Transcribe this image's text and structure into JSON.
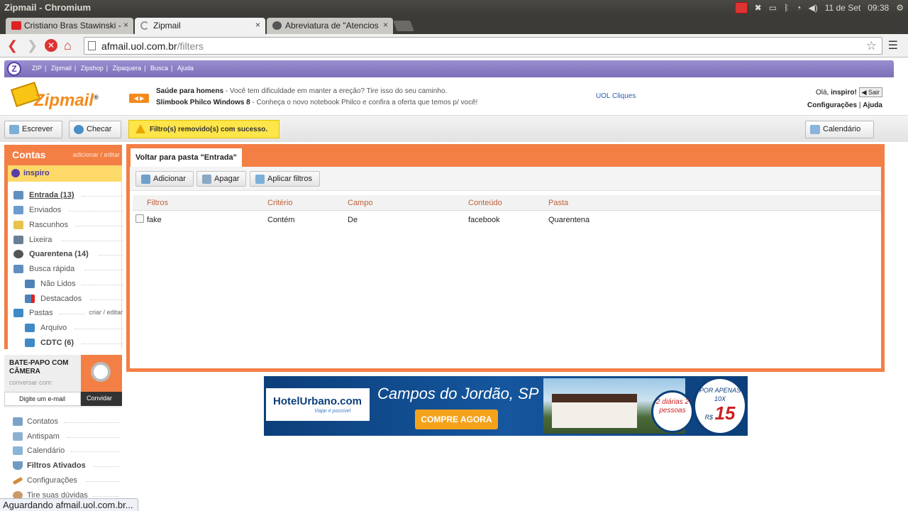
{
  "os": {
    "window_title": "Zipmail - Chromium",
    "date": "11 de Set",
    "time": "09:38"
  },
  "browser": {
    "tabs": [
      {
        "title": "Cristiano Bras Stawinski -",
        "favicon": "youtube-icon",
        "active": false
      },
      {
        "title": "Zipmail",
        "favicon": "loading-icon",
        "active": true
      },
      {
        "title": "Abreviatura de \"Atencios",
        "favicon": "avatar-icon",
        "active": false
      }
    ],
    "tab_close": "×",
    "url_host": "afmail.uol.com.br",
    "url_path": "/filters",
    "status_text": "Aguardando afmail.uol.com.br..."
  },
  "zipbar": {
    "links": [
      "ZIP",
      "Zipmail",
      "Zipshop",
      "Zipaquera",
      "Busca",
      "Ajuda"
    ],
    "separator": "|"
  },
  "header": {
    "logo_text": "Zipmail",
    "logo_reg": "®",
    "ads": [
      {
        "title": "Saúde para homens",
        "text": " - Você tem dificuldade em manter a ereção? Tire isso do seu caminho."
      },
      {
        "title": "Slimbook Philco Windows 8",
        "text": " - Conheça o novo notebook Philco e confira a oferta que temos p/ você!"
      }
    ],
    "uol_cliques": "UOL Cliques",
    "greeting": "Olá, ",
    "username": "inspiro!",
    "sair": "Sair",
    "configuracoes": "Configurações",
    "ajuda": "Ajuda",
    "sep": "|"
  },
  "toolbar": {
    "escrever": "Escrever",
    "checar": "Checar",
    "success": "Filtro(s) removido(s) com sucesso.",
    "calendario": "Calendário"
  },
  "sidebar": {
    "contas": "Contas",
    "adicionar_editar": "adicionar / editar",
    "account": "inspiro",
    "folders": [
      {
        "label": "Entrada (13)",
        "bold": true,
        "icon": "inbox-icon"
      },
      {
        "label": "Enviados",
        "bold": false,
        "icon": "sent-icon"
      },
      {
        "label": "Rascunhos",
        "bold": false,
        "icon": "drafts-icon"
      },
      {
        "label": "Lixeira",
        "bold": false,
        "icon": "trash-icon"
      },
      {
        "label": "Quarentena (14)",
        "bold": true,
        "icon": "quarantine-icon"
      },
      {
        "label": "Busca rápida",
        "bold": false,
        "icon": "search-folder-icon"
      },
      {
        "label": "Não Lidos",
        "bold": false,
        "icon": "unread-icon"
      },
      {
        "label": "Destacados",
        "bold": false,
        "icon": "flagged-icon"
      },
      {
        "label": "Pastas",
        "bold": false,
        "icon": "folders-icon"
      },
      {
        "label": "Arquivo",
        "bold": false,
        "icon": "folder-icon"
      },
      {
        "label": "CDTC (6)",
        "bold": true,
        "icon": "folder-icon"
      }
    ],
    "criar_editar": "criar / editar",
    "chat_title": "BATE-PAPO COM CÂMERA",
    "chat_sub": "conversar com:",
    "chat_input": "Digite um e-mail",
    "chat_button": "Convidar",
    "tools": [
      {
        "label": "Contatos",
        "bold": false,
        "icon": "contacts-icon"
      },
      {
        "label": "Antispam",
        "bold": false,
        "icon": "antispam-icon"
      },
      {
        "label": "Calendário",
        "bold": false,
        "icon": "calendar-icon"
      },
      {
        "label": "Filtros Ativados",
        "bold": true,
        "icon": "filter-icon"
      },
      {
        "label": "Configurações",
        "bold": false,
        "icon": "settings-icon"
      },
      {
        "label": "Tire suas dúvidas",
        "bold": false,
        "icon": "help-icon"
      }
    ]
  },
  "main": {
    "back": "Voltar para pasta \"Entrada\"",
    "buttons": [
      "Adicionar",
      "Apagar",
      "Aplicar filtros"
    ],
    "columns": [
      "Filtros",
      "Critério",
      "Campo",
      "Conteúdo",
      "Pasta"
    ],
    "rows": [
      [
        "fake",
        "Contém",
        "De",
        "facebook",
        "Quarentena"
      ]
    ]
  },
  "banner": {
    "brand": "HotelUrbano.com",
    "tagline": "Viajar é possível",
    "city": "Campos do Jordão, SP",
    "cta": "COMPRE AGORA",
    "diarias": "2 diárias 2 pessoas",
    "por_apenas": "POR APENAS 10X",
    "currency": "R$",
    "price": "15"
  },
  "colors": {
    "accent": "#f37f45",
    "purple": "#7c6eb9",
    "notice": "#fde54a"
  }
}
